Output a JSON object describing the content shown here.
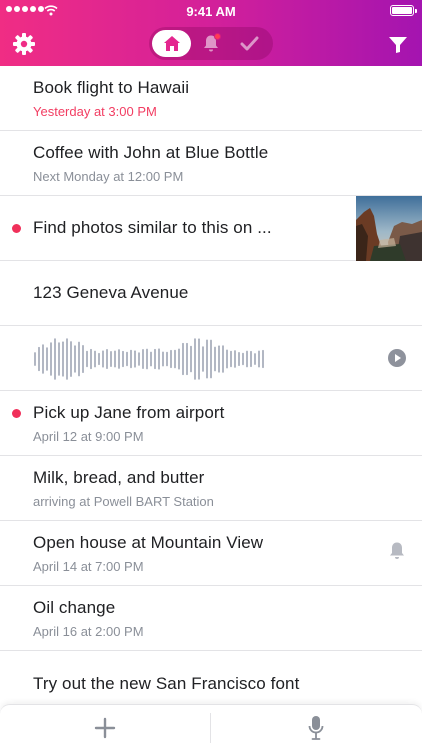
{
  "status_bar": {
    "time": "9:41 AM"
  },
  "header": {
    "icons": {
      "settings": "gear-icon",
      "filter": "filter-icon"
    },
    "tabs": [
      {
        "name": "home",
        "icon": "home-icon",
        "active": true
      },
      {
        "name": "reminders",
        "icon": "bell-icon",
        "badge": true
      },
      {
        "name": "done",
        "icon": "checkmark-icon"
      }
    ]
  },
  "colors": {
    "accent": "#ec2a88",
    "accent_end": "#a414b0",
    "unread_dot": "#f0305a",
    "due_red": "#f23d62",
    "muted_text": "#8a8f98"
  },
  "items": [
    {
      "title": "Book flight to Hawaii",
      "subtitle": "Yesterday at 3:00 PM",
      "subtitle_overdue": true
    },
    {
      "title": "Coffee with John at Blue Bottle",
      "subtitle": "Next Monday at 12:00 PM"
    },
    {
      "title": "Find photos similar to this on ...",
      "unread": true,
      "has_image": true
    },
    {
      "title": "123 Geneva Avenue"
    },
    {
      "type": "voice-note",
      "icon": "play-icon"
    },
    {
      "title": "Pick up Jane from airport",
      "subtitle": "April 12 at 9:00 PM",
      "unread": true
    },
    {
      "title": "Milk, bread, and butter",
      "subtitle": "arriving at Powell BART Station"
    },
    {
      "title": "Open house at Mountain View",
      "subtitle": "April 14 at 7:00 PM",
      "icon": "bell-icon"
    },
    {
      "title": "Oil change",
      "subtitle": "April 16 at 2:00 PM"
    },
    {
      "title": "Try out the new San Francisco font"
    }
  ],
  "bottom_bar": {
    "add_icon": "plus-icon",
    "voice_icon": "microphone-icon"
  }
}
